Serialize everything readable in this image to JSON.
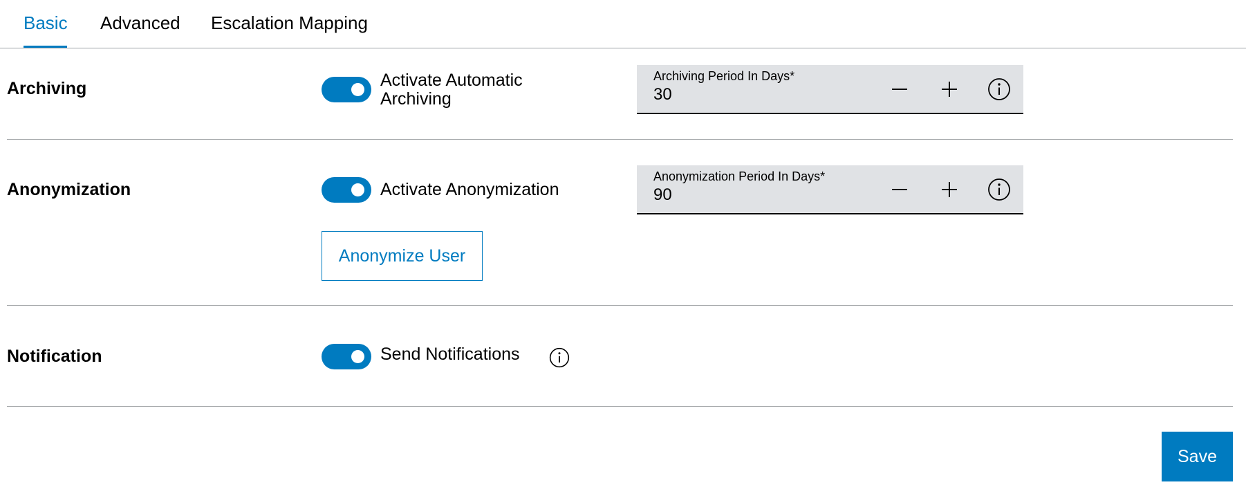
{
  "tabs": [
    {
      "label": "Basic",
      "active": true
    },
    {
      "label": "Advanced",
      "active": false
    },
    {
      "label": "Escalation Mapping",
      "active": false
    }
  ],
  "archiving": {
    "title": "Archiving",
    "toggle_label": "Activate Automatic Archiving",
    "toggle_on": true,
    "period_label": "Archiving Period In Days*",
    "period_value": "30"
  },
  "anonymization": {
    "title": "Anonymization",
    "toggle_label": "Activate Anonymization",
    "toggle_on": true,
    "period_label": "Anonymization Period In Days*",
    "period_value": "90",
    "anonymize_user_label": "Anonymize User"
  },
  "notification": {
    "title": "Notification",
    "toggle_label": "Send Notifications",
    "toggle_on": true
  },
  "save_label": "Save",
  "colors": {
    "accent": "#007bc0",
    "field_background": "#e0e2e5",
    "divider": "#a6a9ab"
  },
  "icons": {
    "decrement": "minus-icon",
    "increment": "plus-icon",
    "info": "info-icon"
  }
}
